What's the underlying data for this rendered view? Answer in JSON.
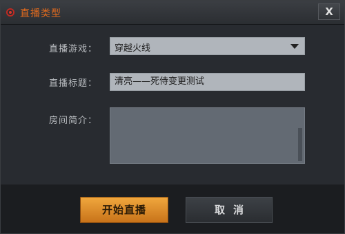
{
  "window": {
    "title": "直播类型",
    "close_glyph": "X"
  },
  "form": {
    "game": {
      "label": "直播游戏：",
      "value": "穿越火线"
    },
    "stream_title": {
      "label": "直播标题：",
      "value": "清亮——死侍变更测试"
    },
    "intro": {
      "label": "房间简介：",
      "value": ""
    }
  },
  "buttons": {
    "start_label": "开始直播",
    "cancel_label": "取消"
  },
  "colors": {
    "title_accent": "#e06a1e",
    "start_button": "#e0902c",
    "field_bg": "#b0b5bb"
  },
  "icons": [
    "record-icon",
    "close-icon",
    "dropdown-arrow-icon"
  ]
}
